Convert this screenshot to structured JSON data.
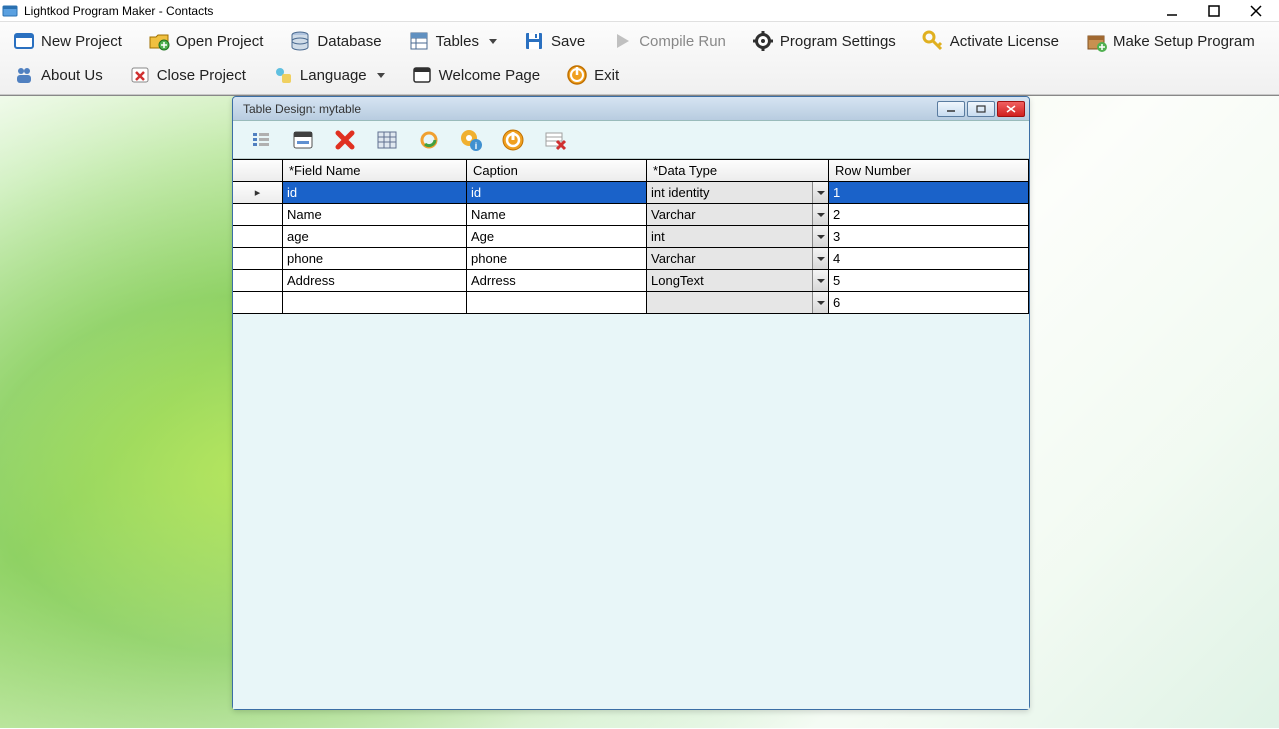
{
  "window": {
    "title": "Lightkod Program Maker - Contacts"
  },
  "toolbar": {
    "row1": {
      "new_project": "New Project",
      "open_project": "Open Project",
      "database": "Database",
      "tables": "Tables",
      "save": "Save",
      "compile_run": "Compile  Run",
      "program_settings": "Program Settings",
      "activate_license": "Activate License",
      "make_setup": "Make Setup Program"
    },
    "row2": {
      "about_us": "About Us",
      "close_project": "Close Project",
      "language": "Language",
      "welcome_page": "Welcome Page",
      "exit": "Exit"
    }
  },
  "child_window": {
    "title": "Table Design: mytable"
  },
  "grid": {
    "headers": {
      "field_name": "*Field Name",
      "caption": "Caption",
      "data_type": "*Data Type",
      "row_number": "Row Number"
    },
    "rows": [
      {
        "field": "id",
        "caption": "id",
        "dtype": "int identity",
        "rownum": "1",
        "selected": true
      },
      {
        "field": "Name",
        "caption": "Name",
        "dtype": "Varchar",
        "rownum": "2",
        "selected": false
      },
      {
        "field": "age",
        "caption": "Age",
        "dtype": "int",
        "rownum": "3",
        "selected": false
      },
      {
        "field": "phone",
        "caption": "phone",
        "dtype": "Varchar",
        "rownum": "4",
        "selected": false
      },
      {
        "field": "Address",
        "caption": "Adrress",
        "dtype": "LongText",
        "rownum": "5",
        "selected": false
      },
      {
        "field": "",
        "caption": "",
        "dtype": "",
        "rownum": "6",
        "selected": false
      }
    ]
  }
}
